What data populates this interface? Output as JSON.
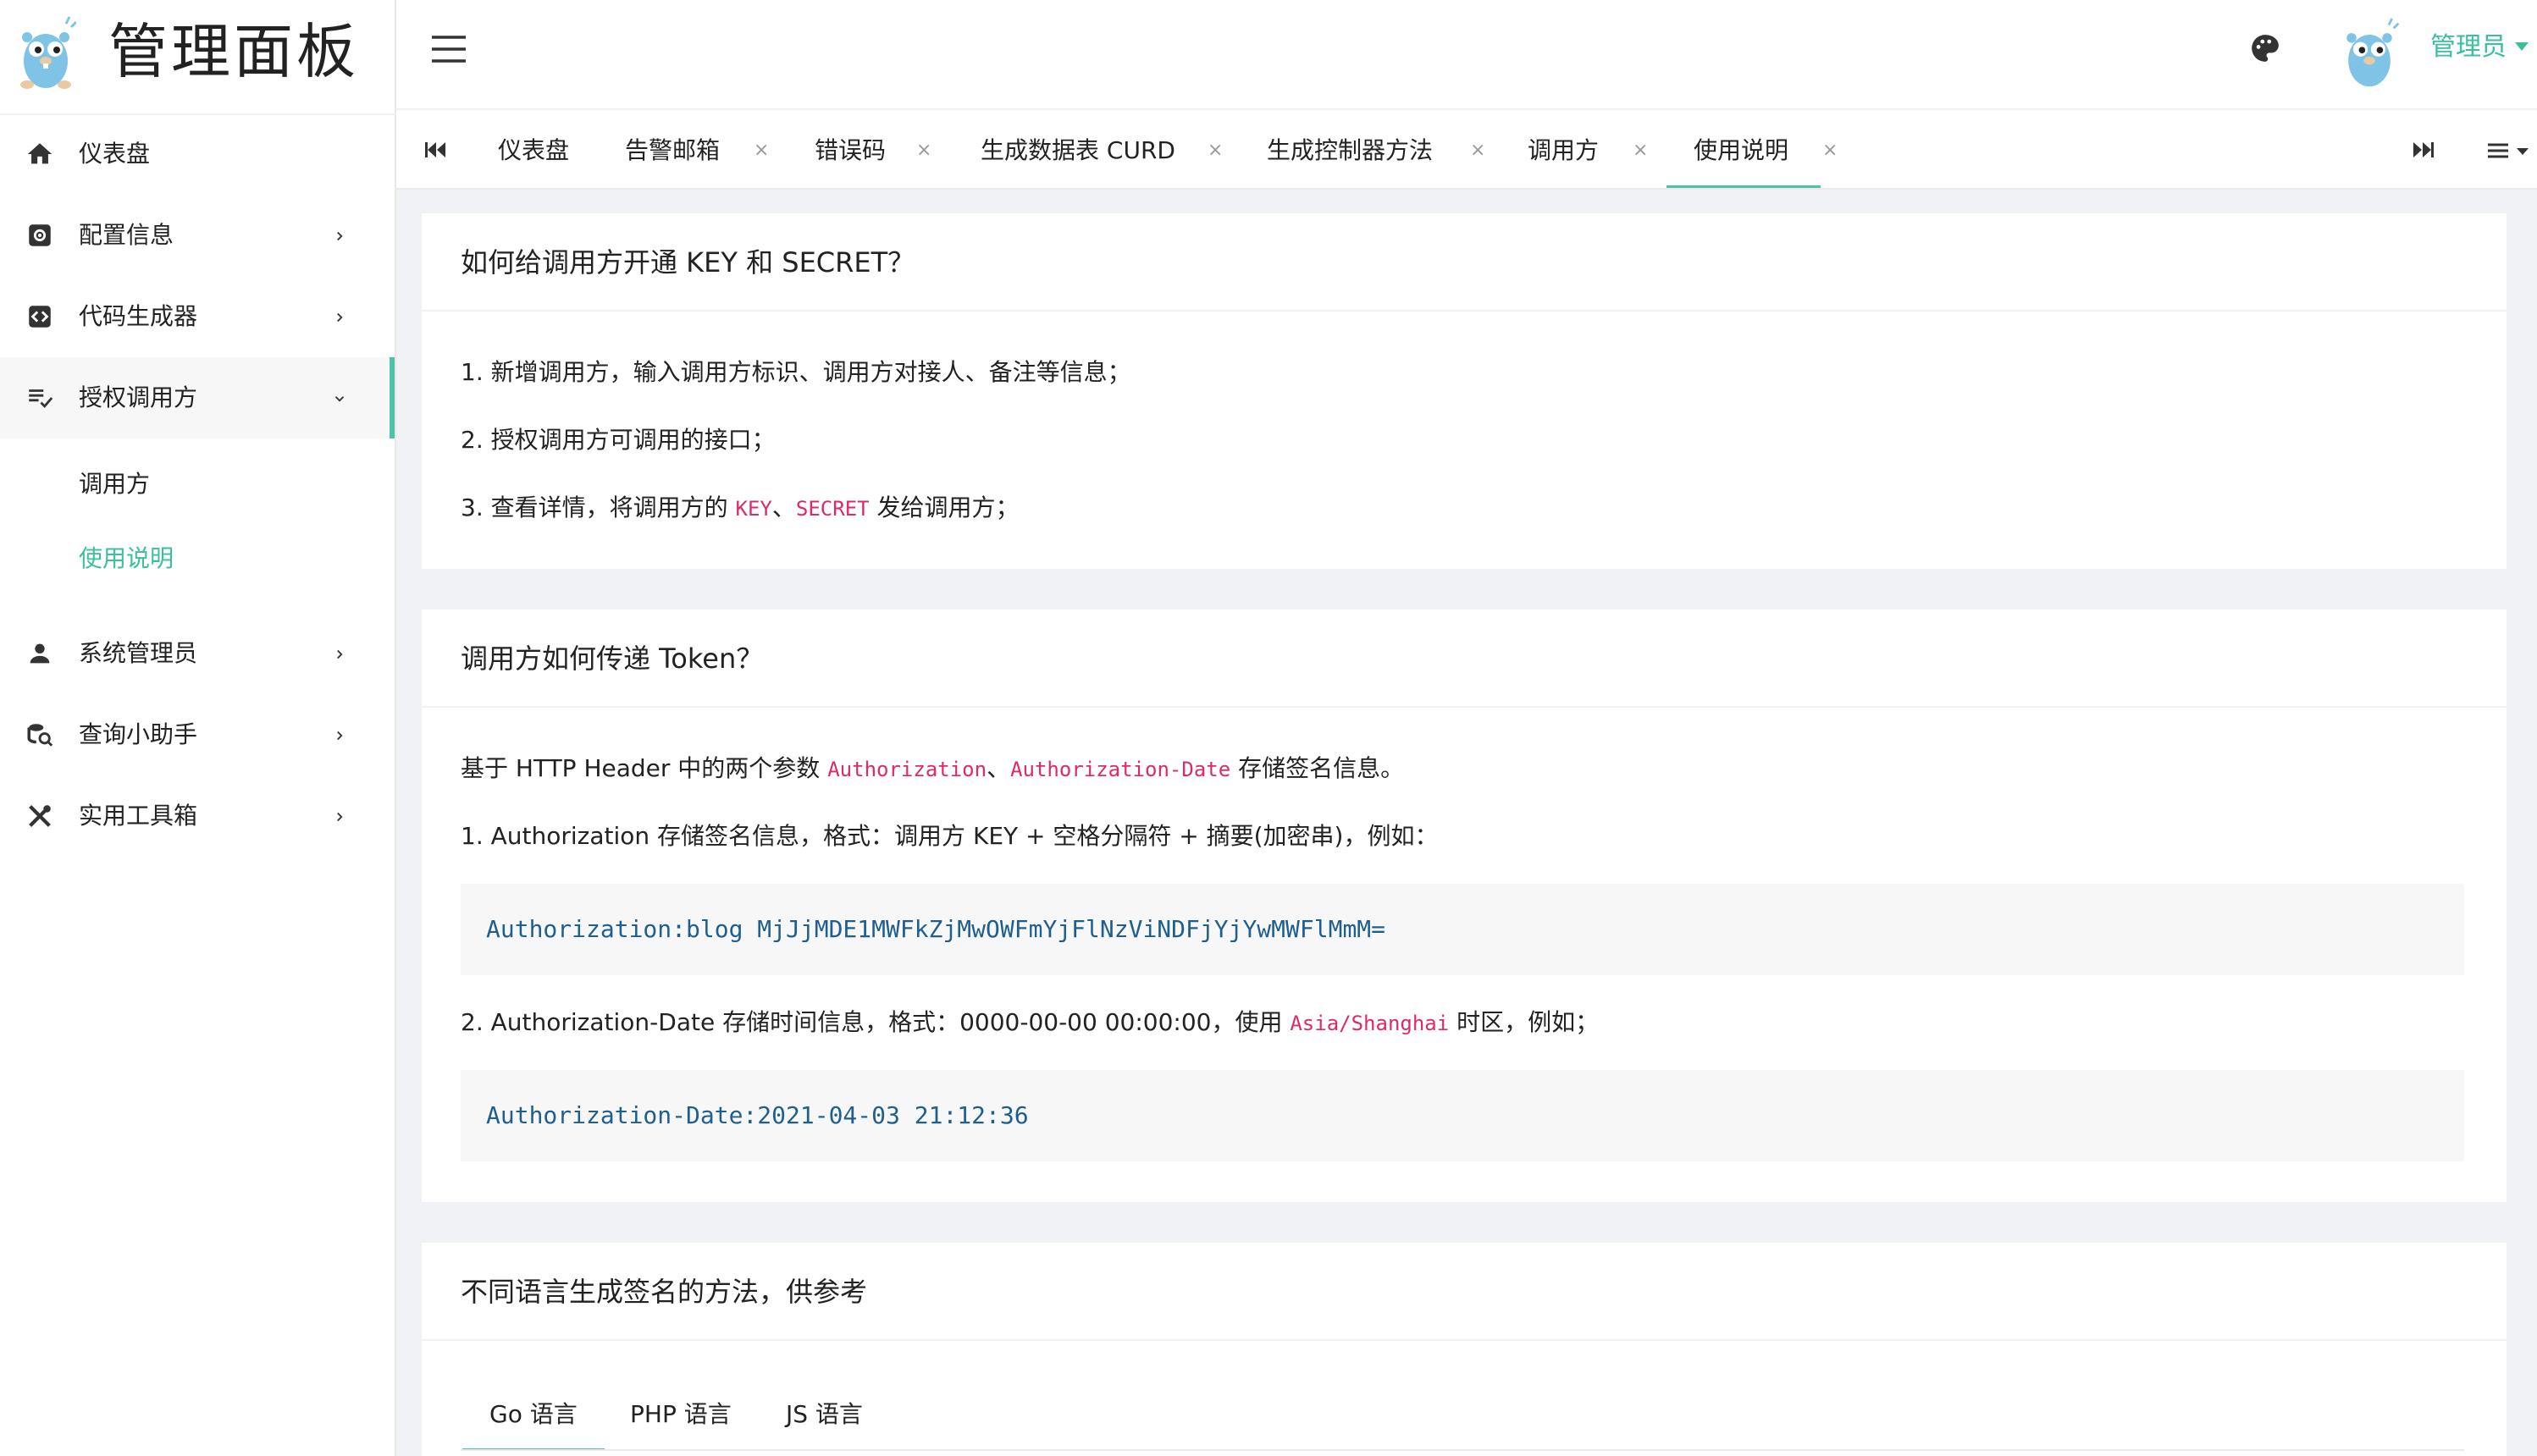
{
  "brand": {
    "title": "管理面板"
  },
  "sidebar": {
    "items": [
      {
        "label": "仪表盘",
        "icon": "home-icon",
        "has_arrow": false
      },
      {
        "label": "配置信息",
        "icon": "settings-icon",
        "has_arrow": true
      },
      {
        "label": "代码生成器",
        "icon": "code-icon",
        "has_arrow": true
      },
      {
        "label": "授权调用方",
        "icon": "playlist-check-icon",
        "has_arrow": true,
        "expanded": true,
        "children": [
          {
            "label": "调用方"
          },
          {
            "label": "使用说明",
            "active": true
          }
        ]
      },
      {
        "label": "系统管理员",
        "icon": "person-icon",
        "has_arrow": true
      },
      {
        "label": "查询小助手",
        "icon": "db-search-icon",
        "has_arrow": true
      },
      {
        "label": "实用工具箱",
        "icon": "tools-icon",
        "has_arrow": true
      }
    ]
  },
  "header": {
    "user_name": "管理员"
  },
  "tabs": [
    {
      "label": "仪表盘",
      "closable": false
    },
    {
      "label": "告警邮箱",
      "closable": true
    },
    {
      "label": "错误码",
      "closable": true
    },
    {
      "label": "生成数据表 CURD",
      "closable": true
    },
    {
      "label": "生成控制器方法",
      "closable": true
    },
    {
      "label": "调用方",
      "closable": true
    },
    {
      "label": "使用说明",
      "closable": true,
      "active": true
    }
  ],
  "tab_close_glyph": "×",
  "card1": {
    "title": "如何给调用方开通 KEY 和 SECRET？",
    "line1": "1. 新增调用方，输入调用方标识、调用方对接人、备注等信息；",
    "line2": "2. 授权调用方可调用的接口；",
    "line3_prefix": "3. 查看详情，将调用方的 ",
    "line3_code1": "KEY",
    "line3_sep": "、",
    "line3_code2": "SECRET",
    "line3_suffix": " 发给调用方；"
  },
  "card2": {
    "title": "调用方如何传递 Token？",
    "intro_prefix": "基于 HTTP Header 中的两个参数 ",
    "intro_code1": "Authorization",
    "intro_sep": "、",
    "intro_code2": "Authorization-Date",
    "intro_suffix": " 存储签名信息。",
    "step1": "1. Authorization 存储签名信息，格式：调用方 KEY + 空格分隔符 + 摘要(加密串)，例如：",
    "code1": "Authorization:blog MjJjMDE1MWFkZjMwOWFmYjFlNzViNDFjYjYwMWFlMmM=",
    "step2_prefix": "2. Authorization-Date 存储时间信息，格式：0000-00-00 00:00:00，使用 ",
    "step2_code": "Asia/Shanghai",
    "step2_suffix": " 时区，例如；",
    "code2": "Authorization-Date:2021-04-03 21:12:36"
  },
  "card3": {
    "title": "不同语言生成签名的方法，供参考",
    "lang_tabs": [
      {
        "label": "Go 语言",
        "active": true
      },
      {
        "label": "PHP 语言"
      },
      {
        "label": "JS 语言"
      }
    ]
  },
  "colors": {
    "accent": "#3bbf9f",
    "inline_code": "#dd2a6a",
    "code_block_text": "#1f5f8f"
  }
}
